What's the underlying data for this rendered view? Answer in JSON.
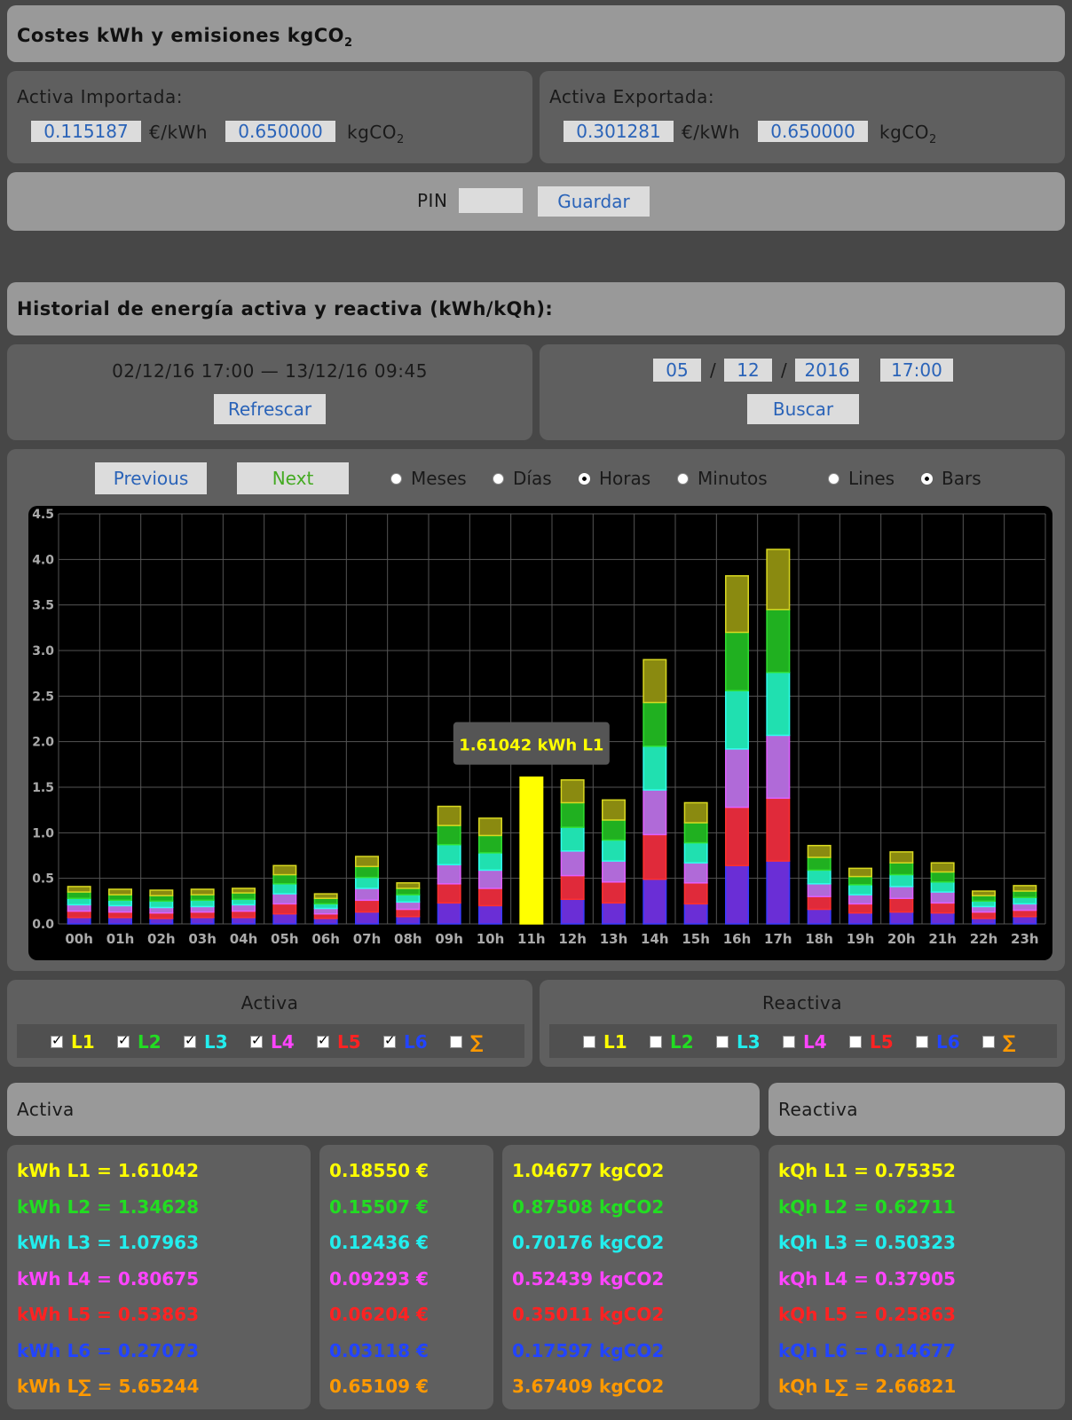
{
  "costs": {
    "title": "Costes kWh y emisiones kgCO",
    "title_sub": "2",
    "imported": {
      "label": "Activa Importada:",
      "price": "0.115187",
      "price_unit": "€/kWh",
      "co2": "0.650000",
      "co2_unit": "kgCO",
      "co2_unit_sub": "2"
    },
    "exported": {
      "label": "Activa Exportada:",
      "price": "0.301281",
      "price_unit": "€/kWh",
      "co2": "0.650000",
      "co2_unit": "kgCO",
      "co2_unit_sub": "2"
    },
    "pin_label": "PIN",
    "pin_value": "",
    "save_label": "Guardar"
  },
  "history": {
    "title": "Historial de energía activa y reactiva (kWh/kQh):",
    "range": "02/12/16 17:00 — 13/12/16 09:45",
    "refresh_label": "Refrescar",
    "day": "05",
    "month": "12",
    "year": "2016",
    "time": "17:00",
    "sep": "/",
    "search_label": "Buscar",
    "previous_label": "Previous",
    "next_label": "Next",
    "period_options": [
      {
        "label": "Meses",
        "selected": false
      },
      {
        "label": "Días",
        "selected": false
      },
      {
        "label": "Horas",
        "selected": true
      },
      {
        "label": "Minutos",
        "selected": false
      }
    ],
    "style_options": [
      {
        "label": "Lines",
        "selected": false
      },
      {
        "label": "Bars",
        "selected": true
      }
    ]
  },
  "colors": {
    "L1": "#ffff00",
    "L2": "#22dd22",
    "L3": "#22eeee",
    "L4": "#ff44ff",
    "L5": "#ff2222",
    "L6": "#2244ff",
    "sum": "#ff9900"
  },
  "chart_data": {
    "type": "bar",
    "stacked": true,
    "categories": [
      "00h",
      "01h",
      "02h",
      "03h",
      "04h",
      "05h",
      "06h",
      "07h",
      "08h",
      "09h",
      "10h",
      "11h",
      "12h",
      "13h",
      "14h",
      "15h",
      "16h",
      "17h",
      "18h",
      "19h",
      "20h",
      "21h",
      "22h",
      "23h"
    ],
    "ylim": [
      0,
      4.5
    ],
    "yticks": [
      "0.0",
      "0.5",
      "1.0",
      "1.5",
      "2.0",
      "2.5",
      "3.0",
      "3.5",
      "4.0",
      "4.5"
    ],
    "grid": true,
    "highlight_index": 11,
    "tooltip": "1.61042 kWh L1",
    "series": [
      {
        "name": "L6",
        "values": [
          0.07,
          0.07,
          0.06,
          0.07,
          0.07,
          0.11,
          0.06,
          0.13,
          0.08,
          0.23,
          0.2,
          0,
          0.27,
          0.23,
          0.49,
          0.22,
          0.64,
          0.69,
          0.16,
          0.12,
          0.13,
          0.12,
          0.06,
          0.08
        ]
      },
      {
        "name": "L5",
        "values": [
          0.07,
          0.06,
          0.06,
          0.06,
          0.07,
          0.11,
          0.05,
          0.13,
          0.08,
          0.21,
          0.19,
          0,
          0.26,
          0.23,
          0.49,
          0.23,
          0.64,
          0.69,
          0.14,
          0.1,
          0.15,
          0.11,
          0.07,
          0.07
        ]
      },
      {
        "name": "L4",
        "values": [
          0.07,
          0.07,
          0.06,
          0.06,
          0.07,
          0.11,
          0.06,
          0.13,
          0.08,
          0.21,
          0.2,
          0,
          0.27,
          0.23,
          0.49,
          0.22,
          0.64,
          0.69,
          0.14,
          0.1,
          0.13,
          0.12,
          0.06,
          0.07
        ]
      },
      {
        "name": "L3",
        "values": [
          0.07,
          0.06,
          0.07,
          0.07,
          0.06,
          0.11,
          0.05,
          0.12,
          0.08,
          0.22,
          0.19,
          0,
          0.26,
          0.23,
          0.48,
          0.22,
          0.64,
          0.69,
          0.15,
          0.11,
          0.13,
          0.11,
          0.06,
          0.07
        ]
      },
      {
        "name": "L2",
        "values": [
          0.07,
          0.06,
          0.06,
          0.06,
          0.07,
          0.1,
          0.06,
          0.12,
          0.07,
          0.21,
          0.19,
          0,
          0.27,
          0.22,
          0.48,
          0.22,
          0.64,
          0.69,
          0.14,
          0.09,
          0.13,
          0.11,
          0.06,
          0.07
        ]
      },
      {
        "name": "L1",
        "values": [
          0.06,
          0.06,
          0.06,
          0.06,
          0.05,
          0.1,
          0.05,
          0.11,
          0.06,
          0.21,
          0.19,
          1.61042,
          0.25,
          0.22,
          0.47,
          0.22,
          0.62,
          0.66,
          0.13,
          0.09,
          0.12,
          0.1,
          0.05,
          0.06
        ]
      }
    ]
  },
  "selectors": {
    "activa": {
      "title": "Activa",
      "items": [
        {
          "label": "L1",
          "checked": true,
          "color": "#ffff00"
        },
        {
          "label": "L2",
          "checked": true,
          "color": "#22dd22"
        },
        {
          "label": "L3",
          "checked": true,
          "color": "#22eeee"
        },
        {
          "label": "L4",
          "checked": true,
          "color": "#ff44ff"
        },
        {
          "label": "L5",
          "checked": true,
          "color": "#ff2222"
        },
        {
          "label": "L6",
          "checked": true,
          "color": "#2244ff"
        },
        {
          "label": "∑",
          "checked": false,
          "color": "#ff9900"
        }
      ]
    },
    "reactiva": {
      "title": "Reactiva",
      "items": [
        {
          "label": "L1",
          "checked": false,
          "color": "#ffff00"
        },
        {
          "label": "L2",
          "checked": false,
          "color": "#22dd22"
        },
        {
          "label": "L3",
          "checked": false,
          "color": "#22eeee"
        },
        {
          "label": "L4",
          "checked": false,
          "color": "#ff44ff"
        },
        {
          "label": "L5",
          "checked": false,
          "color": "#ff2222"
        },
        {
          "label": "L6",
          "checked": false,
          "color": "#2244ff"
        },
        {
          "label": "∑",
          "checked": false,
          "color": "#ff9900"
        }
      ]
    }
  },
  "totals": {
    "activa_title": "Activa",
    "reactiva_title": "Reactiva",
    "kwh": [
      "kWh L1 = 1.61042",
      "kWh L2 = 1.34628",
      "kWh L3 = 1.07963",
      "kWh L4 = 0.80675",
      "kWh L5 = 0.53863",
      "kWh L6 = 0.27073",
      "kWh L∑ = 5.65244"
    ],
    "cost": [
      "0.18550 €",
      "0.15507 €",
      "0.12436 €",
      "0.09293 €",
      "0.06204 €",
      "0.03118 €",
      "0.65109 €"
    ],
    "co2": [
      "1.04677 kgCO2",
      "0.87508 kgCO2",
      "0.70176 kgCO2",
      "0.52439 kgCO2",
      "0.35011 kgCO2",
      "0.17597 kgCO2",
      "3.67409 kgCO2"
    ],
    "kqh": [
      "kQh L1 = 0.75352",
      "kQh L2 = 0.62711",
      "kQh L3 = 0.50323",
      "kQh L4 = 0.37905",
      "kQh L5 = 0.25863",
      "kQh L6 = 0.14677",
      "kQh L∑ = 2.66821"
    ],
    "row_colors": [
      "#ffff00",
      "#22dd22",
      "#22eeee",
      "#ff44ff",
      "#ff2222",
      "#2244ff",
      "#ff9900"
    ]
  }
}
